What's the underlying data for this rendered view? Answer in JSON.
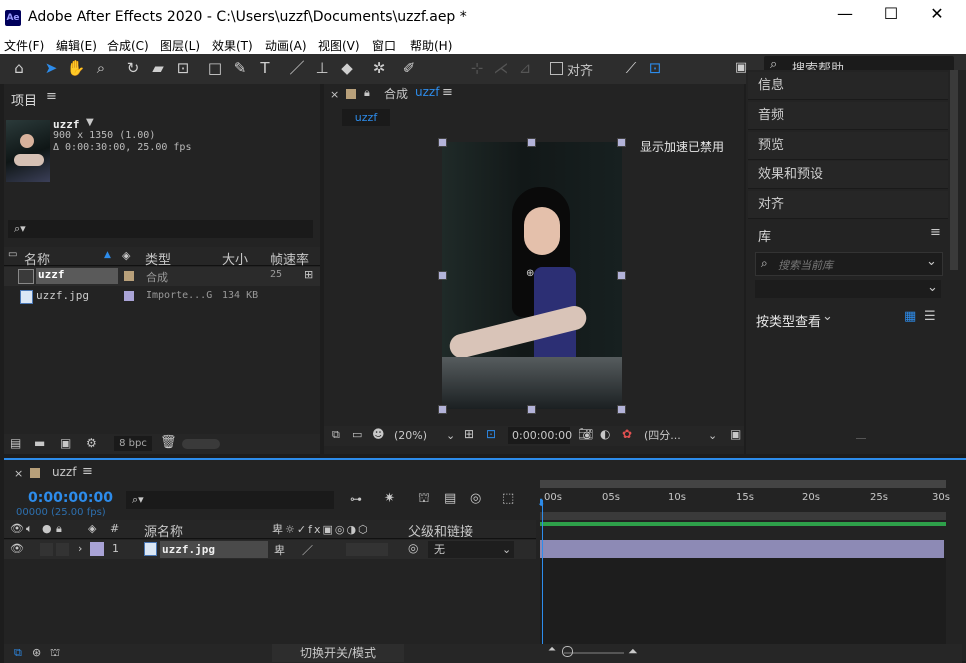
{
  "window": {
    "title": "Adobe After Effects 2020 - C:\\Users\\uzzf\\Documents\\uzzf.aep *",
    "logo": "Ae"
  },
  "menu": [
    "文件(F)",
    "编辑(E)",
    "合成(C)",
    "图层(L)",
    "效果(T)",
    "动画(A)",
    "视图(V)",
    "窗口",
    "帮助(H)"
  ],
  "toolbar": {
    "align_label": "对齐",
    "search_placeholder": "搜索帮助"
  },
  "project": {
    "panel_title": "项目",
    "thumb": {
      "name": "uzzf",
      "dims": "900 x 1350 (1.00)",
      "duration": "Δ 0:00:30:00, 25.00 fps"
    },
    "search_icon": "⌕▾",
    "columns": [
      "名称",
      "类型",
      "大小",
      "帧速率"
    ],
    "items": [
      {
        "name": "uzzf",
        "type": "合成",
        "size": "",
        "fps": "25"
      },
      {
        "name": "uzzf.jpg",
        "type": "Importe...G",
        "size": "134 KB",
        "fps": ""
      }
    ],
    "bpc": "8 bpc"
  },
  "composition": {
    "tab_label": "合成",
    "comp_name": "uzzf",
    "subtab": "uzzf",
    "gpu_notice": "显示加速已禁用",
    "zoom": "(20%)",
    "timecode": "0:00:00:00",
    "view": "(四分..."
  },
  "right_panel": {
    "items": [
      "信息",
      "音频",
      "预览",
      "效果和预设",
      "对齐"
    ],
    "library": {
      "title": "库",
      "search_placeholder": "搜索当前库",
      "view_by": "按类型查看"
    }
  },
  "timeline": {
    "comp_name": "uzzf",
    "timecode": "0:00:00:00",
    "frame_info": "00000 (25.00 fps)",
    "ruler": [
      "00s",
      "05s",
      "10s",
      "15s",
      "20s",
      "25s",
      "30s"
    ],
    "col_source": "源名称",
    "col_parent": "父级和链接",
    "layer": {
      "num": "1",
      "name": "uzzf.jpg",
      "parent": "无"
    },
    "toggle_label": "切换开关/模式"
  }
}
